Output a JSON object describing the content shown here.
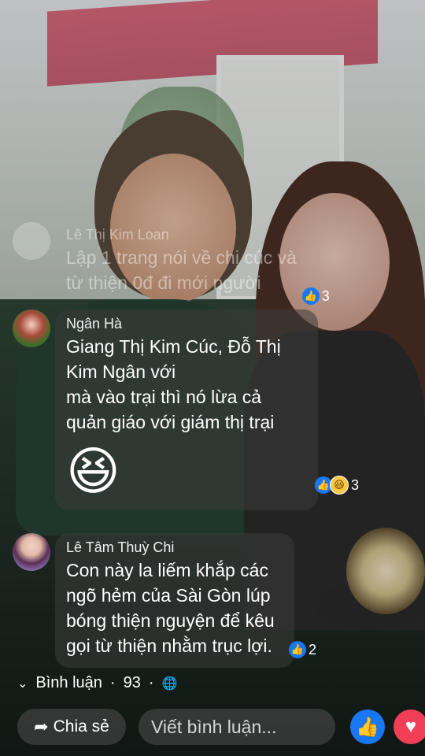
{
  "comments": [
    {
      "author": "Lê Thị Kim Loan",
      "text": "Lập 1 trang nói về chị cúc và\ntừ thiện 0đ đi mới người",
      "reaction_count": "3",
      "faded": true
    },
    {
      "author": "Ngân Hà",
      "text": "Giang Thị Kim Cúc, Đỗ Thị\nKim Ngân với \nmà vào trại thì nó lừa cả\nquản giáo với giám thị trại",
      "emoji": "😆",
      "reaction_count": "3"
    },
    {
      "author": "Lê Tâm Thuỳ Chi",
      "text": "Con này la liếm khắp các\nngõ hẻm của Sài Gòn lúp\nbóng thiện nguyện để kêu\ngọi từ thiện nhằm trục lợi.",
      "reaction_count": "2"
    }
  ],
  "footer": {
    "comments_label": "Bình luận",
    "comments_count": "93",
    "share_label": "Chia sẻ",
    "comment_placeholder": "Viết bình luận..."
  },
  "icons": {
    "like": "like-icon",
    "haha": "haha-icon",
    "love": "love-icon",
    "share": "share-arrow-icon",
    "chevron": "chevron-down-icon",
    "globe": "globe-icon"
  },
  "colors": {
    "like_blue": "#1877f2",
    "love_red": "#f33e58"
  }
}
